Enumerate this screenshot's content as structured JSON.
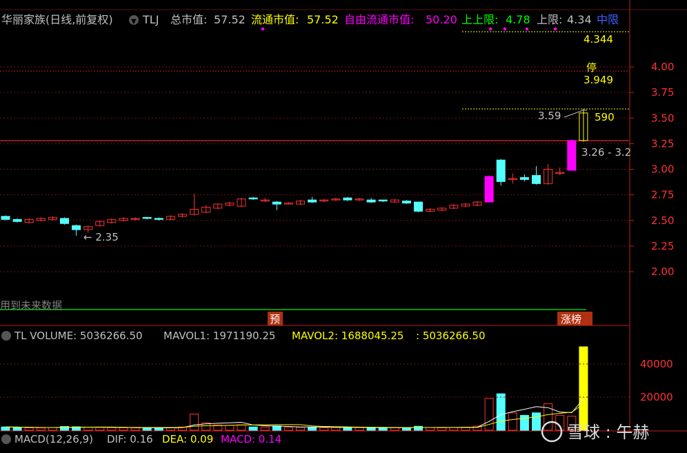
{
  "header": {
    "stock_name": "华丽家族(日线,前复权)",
    "code": "TLJ",
    "total_mv_label": "总市值:",
    "total_mv": "57.52",
    "float_mv_label": "流通市值:",
    "float_mv": "57.52",
    "free_float_label": "自由流通市值:",
    "free_float": "50.20",
    "upper_upper_label": "上上限:",
    "upper_upper": "4.78",
    "upper_label": "上限:",
    "upper": "4.34",
    "middle_label": "中限"
  },
  "annotations": {
    "upper_value": "4.344",
    "limit_up_mark": "停",
    "limit_up_value": "3.949",
    "high_value": "3.59",
    "high_right": "590",
    "last_range": "3.26 - 3.2",
    "low_marker": "← 2.35",
    "future_data": "用到未来数据",
    "forecast_badge": "预",
    "rank_badge": "涨榜"
  },
  "volume_header": {
    "label": "TL VOLUME: 5036266.50",
    "mavol1": "MAVOL1: 1971190.25",
    "mavol2": "MAVOL2: 1688045.25",
    "current": ": 5036266.50"
  },
  "macd_header": {
    "label": "MACD(12,26,9)",
    "dif": "DIF: 0.16",
    "dea": "DEA: 0.09",
    "macd": "MACD: 0.14"
  },
  "price_axis": {
    "ticks": [
      "4.00",
      "3.75",
      "3.50",
      "3.25",
      "3.00",
      "2.75",
      "2.50",
      "2.25",
      "2.00"
    ]
  },
  "volume_axis": {
    "ticks": [
      "40000",
      "20000"
    ]
  },
  "watermark": "雪球 : 午赫",
  "colors": {
    "up": "#ff3232",
    "up_fill": "#ff00ff",
    "down": "#54ffff",
    "ma": "#ffffff",
    "mavol2": "#ffff00",
    "header_yellow": "#ffff00",
    "header_magenta": "#ff00ff",
    "header_green": "#00ff00",
    "axis_red": "#ff3232"
  },
  "chart_data": {
    "type": "candlestick",
    "price_range": [
      1.85,
      4.2
    ],
    "volume_range": [
      0,
      52000
    ],
    "candles": [
      {
        "o": 2.54,
        "c": 2.51,
        "h": 2.55,
        "l": 2.5,
        "v": 2000
      },
      {
        "o": 2.51,
        "c": 2.49,
        "h": 2.52,
        "l": 2.48,
        "v": 1800
      },
      {
        "o": 2.48,
        "c": 2.51,
        "h": 2.52,
        "l": 2.47,
        "v": 1500
      },
      {
        "o": 2.5,
        "c": 2.52,
        "h": 2.53,
        "l": 2.49,
        "v": 1400
      },
      {
        "o": 2.51,
        "c": 2.53,
        "h": 2.54,
        "l": 2.5,
        "v": 1600
      },
      {
        "o": 2.52,
        "c": 2.47,
        "h": 2.53,
        "l": 2.46,
        "v": 2300
      },
      {
        "o": 2.45,
        "c": 2.41,
        "h": 2.46,
        "l": 2.35,
        "v": 2100
      },
      {
        "o": 2.41,
        "c": 2.44,
        "h": 2.45,
        "l": 2.38,
        "v": 1900
      },
      {
        "o": 2.45,
        "c": 2.49,
        "h": 2.5,
        "l": 2.44,
        "v": 1700
      },
      {
        "o": 2.48,
        "c": 2.51,
        "h": 2.52,
        "l": 2.47,
        "v": 1600
      },
      {
        "o": 2.5,
        "c": 2.52,
        "h": 2.53,
        "l": 2.49,
        "v": 1500
      },
      {
        "o": 2.51,
        "c": 2.52,
        "h": 2.53,
        "l": 2.5,
        "v": 1400
      },
      {
        "o": 2.53,
        "c": 2.52,
        "h": 2.53,
        "l": 2.51,
        "v": 1300
      },
      {
        "o": 2.52,
        "c": 2.51,
        "h": 2.53,
        "l": 2.5,
        "v": 1400
      },
      {
        "o": 2.51,
        "c": 2.54,
        "h": 2.55,
        "l": 2.5,
        "v": 1600
      },
      {
        "o": 2.54,
        "c": 2.56,
        "h": 2.57,
        "l": 2.53,
        "v": 2000
      },
      {
        "o": 2.56,
        "c": 2.61,
        "h": 2.76,
        "l": 2.55,
        "v": 9800
      },
      {
        "o": 2.58,
        "c": 2.63,
        "h": 2.65,
        "l": 2.57,
        "v": 4500
      },
      {
        "o": 2.62,
        "c": 2.66,
        "h": 2.67,
        "l": 2.61,
        "v": 3200
      },
      {
        "o": 2.65,
        "c": 2.67,
        "h": 2.68,
        "l": 2.64,
        "v": 3000
      },
      {
        "o": 2.64,
        "c": 2.71,
        "h": 2.72,
        "l": 2.63,
        "v": 3300
      },
      {
        "o": 2.72,
        "c": 2.71,
        "h": 2.73,
        "l": 2.7,
        "v": 2000
      },
      {
        "o": 2.7,
        "c": 2.7,
        "h": 2.72,
        "l": 2.68,
        "v": 1900
      },
      {
        "o": 2.68,
        "c": 2.66,
        "h": 2.69,
        "l": 2.6,
        "v": 2600
      },
      {
        "o": 2.67,
        "c": 2.67,
        "h": 2.68,
        "l": 2.66,
        "v": 1700
      },
      {
        "o": 2.66,
        "c": 2.69,
        "h": 2.7,
        "l": 2.65,
        "v": 1800
      },
      {
        "o": 2.7,
        "c": 2.68,
        "h": 2.73,
        "l": 2.67,
        "v": 1900
      },
      {
        "o": 2.69,
        "c": 2.7,
        "h": 2.71,
        "l": 2.68,
        "v": 1600
      },
      {
        "o": 2.7,
        "c": 2.71,
        "h": 2.72,
        "l": 2.69,
        "v": 1700
      },
      {
        "o": 2.72,
        "c": 2.7,
        "h": 2.73,
        "l": 2.69,
        "v": 1800
      },
      {
        "o": 2.7,
        "c": 2.71,
        "h": 2.72,
        "l": 2.69,
        "v": 1600
      },
      {
        "o": 2.7,
        "c": 2.68,
        "h": 2.72,
        "l": 2.67,
        "v": 1500
      },
      {
        "o": 2.7,
        "c": 2.69,
        "h": 2.7,
        "l": 2.68,
        "v": 1400
      },
      {
        "o": 2.68,
        "c": 2.7,
        "h": 2.71,
        "l": 2.67,
        "v": 1500
      },
      {
        "o": 2.69,
        "c": 2.67,
        "h": 2.7,
        "l": 2.66,
        "v": 1500
      },
      {
        "o": 2.68,
        "c": 2.59,
        "h": 2.68,
        "l": 2.58,
        "v": 2400
      },
      {
        "o": 2.59,
        "c": 2.61,
        "h": 2.62,
        "l": 2.58,
        "v": 1600
      },
      {
        "o": 2.6,
        "c": 2.62,
        "h": 2.63,
        "l": 2.59,
        "v": 1500
      },
      {
        "o": 2.62,
        "c": 2.65,
        "h": 2.66,
        "l": 2.61,
        "v": 1700
      },
      {
        "o": 2.64,
        "c": 2.66,
        "h": 2.67,
        "l": 2.63,
        "v": 1800
      },
      {
        "o": 2.65,
        "c": 2.68,
        "h": 2.69,
        "l": 2.64,
        "v": 2500
      },
      {
        "o": 2.68,
        "c": 2.93,
        "h": 2.94,
        "l": 2.68,
        "v": 19200
      },
      {
        "o": 3.09,
        "c": 2.88,
        "h": 3.1,
        "l": 2.84,
        "v": 22000
      },
      {
        "o": 2.9,
        "c": 2.91,
        "h": 2.96,
        "l": 2.86,
        "v": 10500
      },
      {
        "o": 2.92,
        "c": 2.9,
        "h": 2.95,
        "l": 2.88,
        "v": 9000
      },
      {
        "o": 2.94,
        "c": 2.86,
        "h": 3.03,
        "l": 2.85,
        "v": 10500
      },
      {
        "o": 2.86,
        "c": 3.0,
        "h": 3.05,
        "l": 2.85,
        "v": 16000
      },
      {
        "o": 2.96,
        "c": 2.97,
        "h": 3.02,
        "l": 2.94,
        "v": 9000
      },
      {
        "o": 2.99,
        "c": 3.28,
        "h": 3.29,
        "l": 2.99,
        "v": 8500
      },
      {
        "o": 3.28,
        "c": 3.55,
        "h": 3.59,
        "l": 3.27,
        "v": 50363
      }
    ]
  }
}
